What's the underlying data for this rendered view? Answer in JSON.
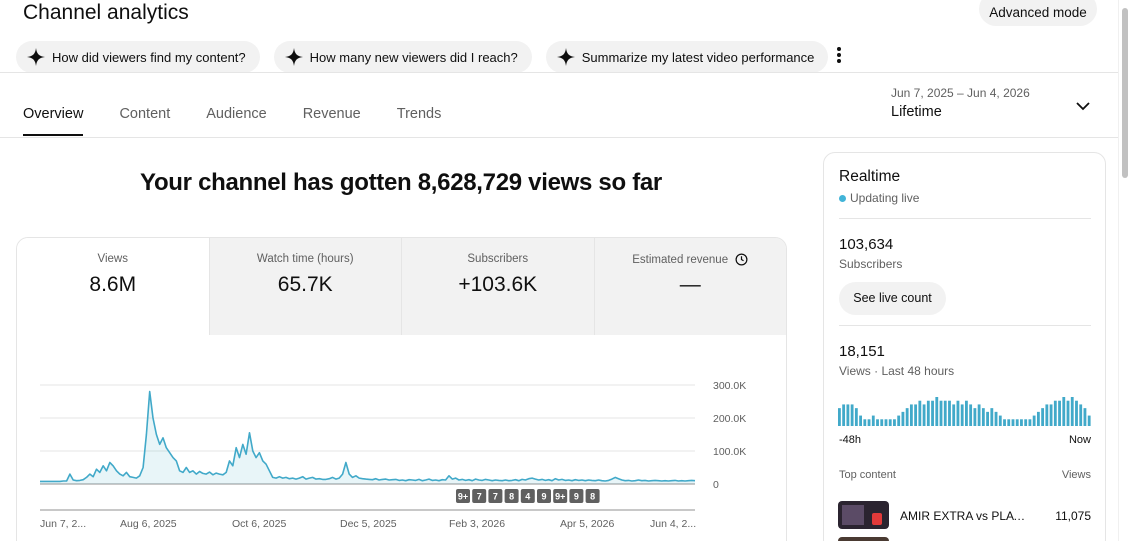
{
  "header": {
    "title": "Channel analytics",
    "advanced_mode": "Advanced mode"
  },
  "chips": [
    {
      "label": "How did viewers find my content?",
      "icon": "sparkle-icon"
    },
    {
      "label": "How many new viewers did I reach?",
      "icon": "sparkle-icon"
    },
    {
      "label": "Summarize my latest video performance",
      "icon": "sparkle-icon"
    }
  ],
  "tabs": [
    {
      "label": "Overview",
      "active": true
    },
    {
      "label": "Content"
    },
    {
      "label": "Audience"
    },
    {
      "label": "Revenue"
    },
    {
      "label": "Trends"
    }
  ],
  "date_picker": {
    "range": "Jun 7, 2025 – Jun 4, 2026",
    "period": "Lifetime"
  },
  "headline": "Your channel has gotten 8,628,729 views so far",
  "metrics": [
    {
      "label": "Views",
      "value": "8.6M"
    },
    {
      "label": "Watch time (hours)",
      "value": "65.7K"
    },
    {
      "label": "Subscribers",
      "value": "+103.6K"
    },
    {
      "label": "Estimated revenue",
      "value": "—",
      "icon": "clock-icon"
    }
  ],
  "chart_data": {
    "type": "area",
    "series": [
      {
        "color": "#41a9c9",
        "values": [
          8000,
          8000,
          8000,
          8000,
          8000,
          8000,
          8000,
          9000,
          9000,
          30000,
          12000,
          10000,
          11000,
          13000,
          20000,
          30000,
          22000,
          45000,
          35000,
          55000,
          40000,
          65000,
          55000,
          40000,
          30000,
          25000,
          35000,
          22000,
          20000,
          18000,
          25000,
          50000,
          150000,
          280000,
          200000,
          150000,
          120000,
          140000,
          110000,
          95000,
          80000,
          70000,
          40000,
          35000,
          50000,
          35000,
          40000,
          30000,
          38000,
          32000,
          30000,
          36000,
          28000,
          33000,
          30000,
          28000,
          35000,
          70000,
          55000,
          110000,
          80000,
          120000,
          90000,
          155000,
          100000,
          80000,
          95000,
          70000,
          60000,
          40000,
          20000,
          18000,
          22000,
          18000,
          20000,
          16000,
          18000,
          15000,
          18000,
          22000,
          15000,
          18000,
          20000,
          15000,
          16000,
          14000,
          14000,
          16000,
          20000,
          15000,
          18000,
          30000,
          65000,
          30000,
          20000,
          25000,
          18000,
          16000,
          15000,
          14000,
          13000,
          16000,
          12000,
          14000,
          15000,
          12000,
          13000,
          14000,
          11000,
          12000,
          10000,
          13000,
          12000,
          11000,
          14000,
          10000,
          12000,
          15000,
          11000,
          12000,
          10000,
          13000,
          12000,
          25000,
          15000,
          18000,
          12000,
          14000,
          11000,
          13000,
          10000,
          15000,
          12000,
          11000,
          14000,
          12000,
          10000,
          12000,
          11000,
          10000,
          12000,
          10000,
          11000,
          13000,
          10000,
          14000,
          12000,
          16000,
          18000,
          15000,
          12000,
          14000,
          11000,
          13000,
          10000,
          16000,
          12000,
          14000,
          11000,
          12000,
          10000,
          13000,
          11000,
          12000,
          10000,
          12000,
          11000,
          10000,
          12000,
          10000,
          9000,
          11000,
          15000,
          20000,
          16000,
          12000,
          10000,
          11000,
          9000,
          10000,
          12000,
          10000,
          11000,
          9000,
          10000,
          11000,
          10000,
          9000,
          10000,
          9000,
          10000,
          11000,
          9000,
          10000,
          9000,
          10000,
          11000,
          10000
        ]
      }
    ],
    "y_ticks": [
      "300.0K",
      "200.0K",
      "100.0K",
      "0"
    ],
    "ylim": [
      0,
      300000
    ],
    "x_ticks": [
      "Jun 7, 2...",
      "Aug 6, 2025",
      "Oct 6, 2025",
      "Dec 5, 2025",
      "Feb 3, 2026",
      "Apr 5, 2026",
      "Jun 4, 2..."
    ],
    "markers": [
      "9+",
      "7",
      "7",
      "8",
      "4",
      "9",
      "9+",
      "9",
      "8"
    ]
  },
  "realtime": {
    "title": "Realtime",
    "status": "Updating live",
    "subscribers_value": "103,634",
    "subscribers_label": "Subscribers",
    "live_count_button": "See live count",
    "views_value": "18,151",
    "views_label": "Views · Last 48 hours",
    "bars": [
      4,
      5,
      5,
      5,
      4,
      2,
      1,
      1,
      2,
      1,
      1,
      1,
      1,
      1,
      2,
      3,
      4,
      5,
      5,
      6,
      5,
      6,
      6,
      7,
      6,
      6,
      6,
      5,
      6,
      5,
      6,
      5,
      4,
      5,
      4,
      3,
      4,
      3,
      2,
      1,
      1,
      1,
      1,
      1,
      1,
      1,
      2,
      3,
      4,
      5,
      5,
      6,
      6,
      7,
      6,
      7,
      6,
      5,
      4,
      2
    ],
    "axis_left": "-48h",
    "axis_right": "Now",
    "top_content_label": "Top content",
    "top_content_views_label": "Views",
    "top_content": [
      {
        "title": "AMIR EXTRA vs PLAYE...",
        "views": "11,075"
      }
    ]
  }
}
